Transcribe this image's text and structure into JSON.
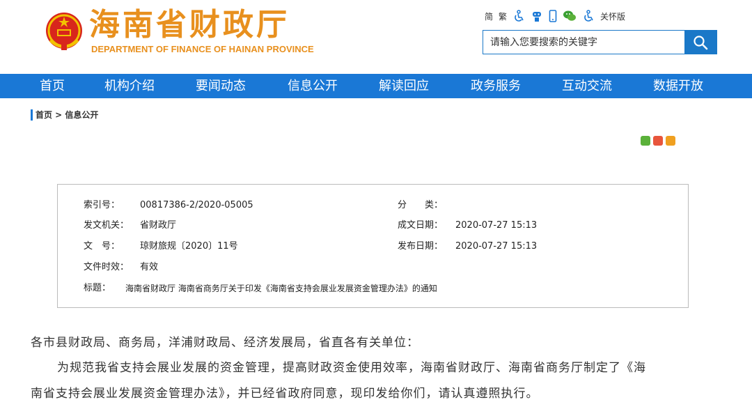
{
  "site": {
    "title_cn": "海南省财政厅",
    "title_en": "DEPARTMENT OF FINANCE OF HAINAN PROVINCE"
  },
  "toolbar": {
    "simplified": "简",
    "traditional": "繁",
    "care_mode": "关怀版"
  },
  "search": {
    "placeholder": "请输入您要搜索的关键字"
  },
  "nav": {
    "items": [
      "首页",
      "机构介绍",
      "要闻动态",
      "信息公开",
      "解读回应",
      "政务服务",
      "互动交流",
      "数据开放"
    ]
  },
  "breadcrumb": "首页 > 信息公开",
  "meta": {
    "index_label": "索引号：",
    "index_value": "00817386-2/2020-05005",
    "category_label": "分　　类：",
    "category_value": "",
    "issuer_label": "发文机关：",
    "issuer_value": "省财政厅",
    "created_label": "成文日期：",
    "created_value": "2020-07-27 15:13",
    "docno_label": "文　号：",
    "docno_value": "琼财旅规〔2020〕11号",
    "published_label": "发布日期：",
    "published_value": "2020-07-27 15:13",
    "validity_label": "文件时效：",
    "validity_value": "有效",
    "title_label": "标题：",
    "title_value": "海南省财政厅 海南省商务厅关于印发《海南省支持会展业发展资金管理办法》的通知"
  },
  "body": {
    "salutation": "各市县财政局、商务局，洋浦财政局、经济发展局，省直各有关单位：",
    "para1_line1": "为规范我省支持会展业发展的资金管理，提高财政资金使用效率，海南省财政厅、海南省商务厅制定了《海",
    "para1_line2": "南省支持会展业发展资金管理办法》，并已经省政府同意，现印发给你们，请认真遵照执行。"
  },
  "colors": {
    "brand_orange": "#e8901e",
    "nav_blue": "#1a78d6",
    "share_wechat": "#5bb13a",
    "share_weibo": "#e8553c",
    "share_qzone": "#f0a020"
  }
}
